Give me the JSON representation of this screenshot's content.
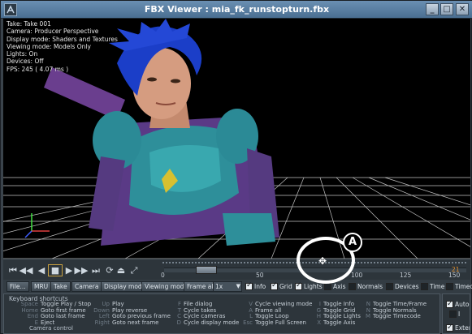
{
  "window": {
    "title": "FBX Viewer : mia_fk_runstopturn.fbx",
    "minimize": "_",
    "maximize": "□",
    "close": "✕"
  },
  "viewport": {
    "info": [
      "Take: Take 001",
      "Camera: Producer Perspective",
      "Display mode: Shaders and Textures",
      "Viewing mode: Models Only",
      "Lights: On",
      "Devices: Off",
      "FPS: 245  ( 4.07 ms )"
    ]
  },
  "timeline": {
    "ticks": [
      "0",
      "50",
      "100",
      "125",
      "150"
    ],
    "end_frame": "21",
    "frame_progress": 0.14
  },
  "toolbar": {
    "buttons": [
      "File...",
      "MRU",
      "Take",
      "Camera",
      "Display mode",
      "Viewing mode",
      "Frame all"
    ],
    "speed_value": "1x",
    "checkboxes": [
      {
        "label": "Info",
        "checked": true
      },
      {
        "label": "Grid",
        "checked": true
      },
      {
        "label": "Lights",
        "checked": true
      },
      {
        "label": "Axis",
        "checked": false
      },
      {
        "label": "Normals",
        "checked": false
      },
      {
        "label": "Devices",
        "checked": false
      },
      {
        "label": "Time",
        "checked": false
      },
      {
        "label": "Timeco",
        "checked": false
      }
    ]
  },
  "shortcuts": {
    "title": "Keyboard shortcuts",
    "columns": [
      [
        {
          "key": "Space",
          "action": "Toggle Play / Stop"
        },
        {
          "key": "Home",
          "action": "Goto first frame"
        },
        {
          "key": "End",
          "action": "Goto last frame"
        },
        {
          "key": "E",
          "action": "Eject"
        },
        {
          "key": "",
          "action": "Camera control"
        }
      ],
      [
        {
          "key": "Up",
          "action": "Play"
        },
        {
          "key": "Down",
          "action": "Play reverse"
        },
        {
          "key": "Left",
          "action": "Goto previous frame"
        },
        {
          "key": "Right",
          "action": "Goto next frame"
        }
      ],
      [
        {
          "key": "F",
          "action": "File dialog"
        },
        {
          "key": "T",
          "action": "Cycle takes"
        },
        {
          "key": "C",
          "action": "Cycle cameras"
        },
        {
          "key": "D",
          "action": "Cycle display mode"
        }
      ],
      [
        {
          "key": "V",
          "action": "Cycle viewing mode"
        },
        {
          "key": "A",
          "action": "Frame all"
        },
        {
          "key": "L",
          "action": "Toggle Loop"
        },
        {
          "key": "Esc",
          "action": "Toggle Full Screen"
        }
      ],
      [
        {
          "key": "I",
          "action": "Toggle Info"
        },
        {
          "key": "G",
          "action": "Toggle Grid"
        },
        {
          "key": "H",
          "action": "Toggle Lights"
        },
        {
          "key": "X",
          "action": "Toggle Axis"
        }
      ],
      [
        {
          "key": "N",
          "action": "Toggle Time/Frame"
        },
        {
          "key": "N",
          "action": "Toggle Normals"
        },
        {
          "key": "M",
          "action": "Toggle Timecode"
        }
      ]
    ]
  },
  "right_panel": {
    "auto_label": "Auto-",
    "i_label": "I",
    "extern_label": "Exter"
  },
  "annotation": {
    "label": "A"
  }
}
